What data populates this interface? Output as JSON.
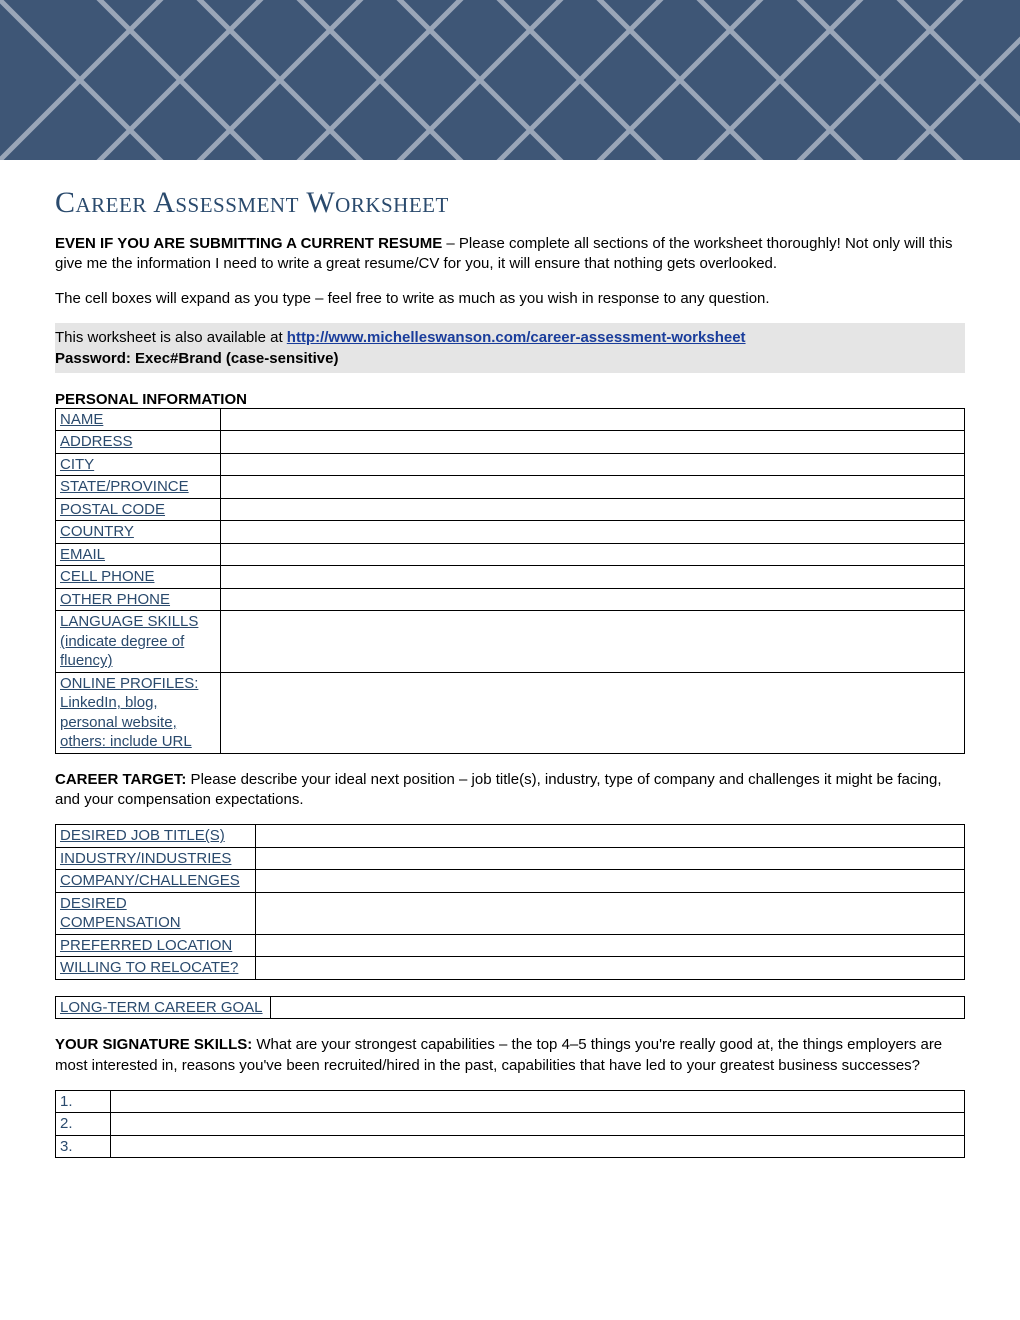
{
  "title": "Career Assessment Worksheet",
  "intro": {
    "lead_bold": "EVEN IF YOU ARE SUBMITTING A CURRENT RESUME",
    "lead_rest": " – Please complete all sections of the worksheet thoroughly! Not only will this give me the information I need to write a great resume/CV for you, it will ensure that nothing gets overlooked.",
    "expand_note": "The cell boxes will expand as you type – feel free to write as much as you wish in response to any question.",
    "link_intro": "This worksheet is also available at ",
    "link_text": "http://www.michelleswanson.com/career-assessment-worksheet",
    "password_label": "Password: Exec#Brand (case-sensitive)"
  },
  "sections": {
    "personal_heading": "PERSONAL INFORMATION",
    "personal_rows": [
      "NAME",
      "ADDRESS",
      "CITY",
      "STATE/PROVINCE",
      "POSTAL CODE",
      "COUNTRY",
      "EMAIL",
      "CELL PHONE",
      "OTHER PHONE",
      "LANGUAGE SKILLS (indicate degree of fluency)",
      "ONLINE PROFILES: LinkedIn, blog, personal website, others: include URL"
    ],
    "career_target_bold": "CAREER TARGET:",
    "career_target_text": " Please describe your ideal next position – job title(s), industry, type of company and challenges it might be facing, and your compensation expectations.",
    "career_rows": [
      "DESIRED JOB TITLE(S)",
      "INDUSTRY/INDUSTRIES",
      "COMPANY/CHALLENGES",
      "DESIRED COMPENSATION",
      "PREFERRED LOCATION",
      "WILLING TO RELOCATE?"
    ],
    "longterm_rows": [
      "LONG-TERM CAREER GOAL"
    ],
    "signature_bold": "YOUR SIGNATURE SKILLS:",
    "signature_text": " What are your strongest capabilities – the top 4–5 things you're really good at, the things employers are most interested in, reasons you've been recruited/hired in the past, capabilities that have led to your greatest business successes?",
    "signature_nums": [
      "1.",
      "2.",
      "3."
    ]
  }
}
